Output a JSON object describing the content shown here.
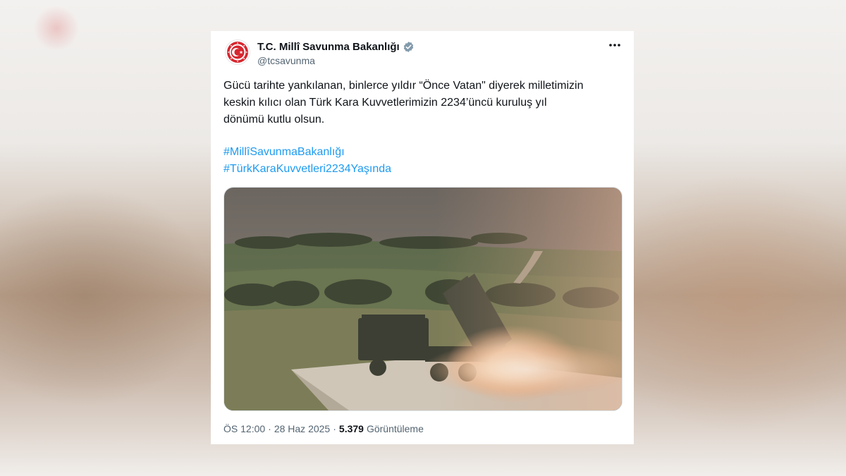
{
  "tweet": {
    "author_name": "T.C. Millî Savunma Bakanlığı",
    "handle": "@tcsavunma",
    "verified_icon": "verified-badge-icon",
    "more_icon": "more-options-icon",
    "avatar_icon": "crescent-star-emblem-icon",
    "text_line1": "Gücü tarihte yankılanan, binlerce yıldır “Önce Vatan\" diyerek milletimizin",
    "text_line2": "keskin kılıcı olan Türk Kara Kuvvetlerimizin 2234’üncü kuruluş yıl",
    "text_line3": "dönümü kutlu olsun.",
    "hashtag1": "#MillîSavunmaBakanlığı",
    "hashtag2": "#TürkKaraKuvvetleri2234Yaşında",
    "time": "ÖS 12:00",
    "dot1": "·",
    "date": "28 Haz 2025",
    "dot2": "·",
    "views_count": "5.379",
    "views_label": "Görüntüleme"
  },
  "colors": {
    "link": "#1d9bf0",
    "verified": "#829aab",
    "text": "#0f1419",
    "muted": "#536471",
    "emblem_red": "#d7262f"
  }
}
